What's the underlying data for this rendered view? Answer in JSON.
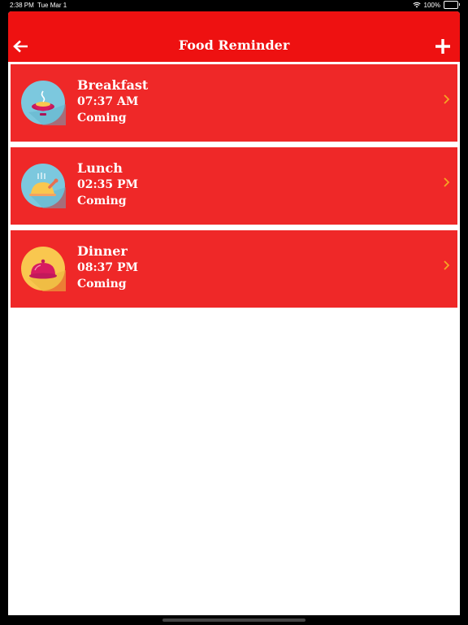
{
  "status_bar": {
    "time": "2:38 PM",
    "date": "Tue Mar 1",
    "battery": "100%"
  },
  "nav": {
    "title": "Food Reminder",
    "back_icon": "arrow-left-icon",
    "add_icon": "plus-icon"
  },
  "meals": [
    {
      "name": "Breakfast",
      "time": "07:37 AM",
      "status": "Coming",
      "icon": "soup-bowl-icon"
    },
    {
      "name": "Lunch",
      "time": "02:35 PM",
      "status": "Coming",
      "icon": "roast-chicken-icon"
    },
    {
      "name": "Dinner",
      "time": "08:37 PM",
      "status": "Coming",
      "icon": "cloche-icon"
    }
  ],
  "colors": {
    "nav": "#ee1111",
    "row": "#ef2828",
    "chevron": "#f5a623",
    "icon_blue": "#7cc8de",
    "icon_yellow": "#f9c74f"
  }
}
